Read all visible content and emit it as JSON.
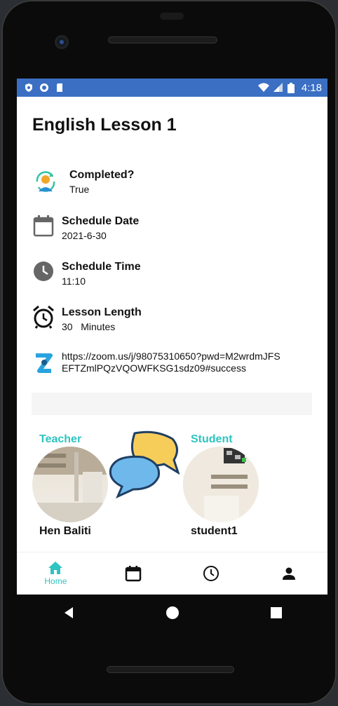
{
  "statusbar": {
    "time": "4:18"
  },
  "lesson": {
    "title": "English Lesson 1",
    "completed_label": "Completed?",
    "completed_value": "True",
    "date_label": "Schedule Date",
    "date_value": "2021-6-30",
    "time_label": "Schedule Time",
    "time_value": "11:10",
    "length_label": "Lesson Length",
    "length_value": "30   Minutes",
    "zoom_link": "https://zoom.us/j/98075310650?pwd=M2wrdmJFSEFTZmlPQzVQOWFKSG1sdz09#success"
  },
  "participants": {
    "teacher_label": "Teacher",
    "teacher_name": "Hen Baliti",
    "student_label": "Student",
    "student_name": "student1"
  },
  "navbar": {
    "home_label": "Home"
  },
  "colors": {
    "accent": "#2ec4c1",
    "statusbar": "#3a6fc4"
  },
  "icons": [
    "user-sync-icon",
    "calendar-icon",
    "clock-icon",
    "alarm-clock-icon",
    "zoom-icon",
    "chat-bubbles-icon",
    "home-icon",
    "person-icon"
  ]
}
